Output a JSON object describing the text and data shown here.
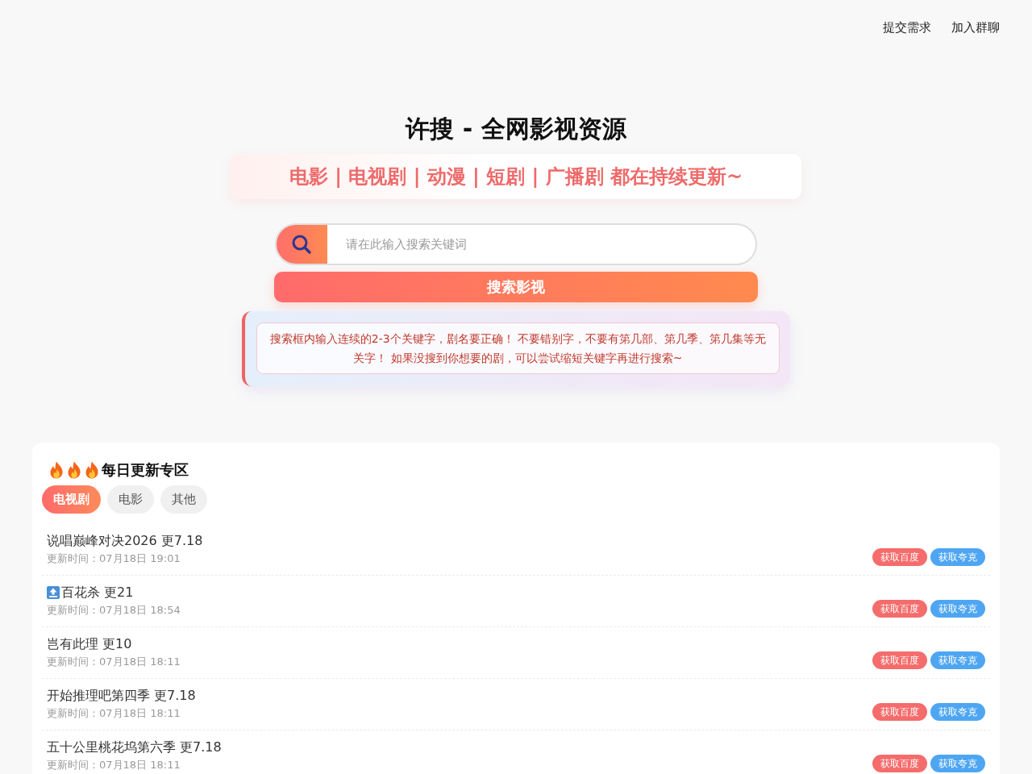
{
  "nav": {
    "links": [
      "提交需求",
      "加入群聊"
    ]
  },
  "hero": {
    "title": "许搜 - 全网影视资源",
    "subtitle": "电影 | 电视剧 | 动漫 | 短剧 | 广播剧 都在持续更新~"
  },
  "search": {
    "placeholder": "请在此输入搜索关键词",
    "button": "搜索影视"
  },
  "notice": "搜索框内输入连续的2-3个关键字，剧名要正确！ 不要错别字，不要有第几部、第几季、第几集等无关字！ 如果没搜到你想要的剧，可以尝试缩短关键字再进行搜索~",
  "updates": {
    "title": "每日更新专区",
    "tabs": [
      {
        "label": "电视剧",
        "selected": true
      },
      {
        "label": "电影",
        "selected": false
      },
      {
        "label": "其他",
        "selected": false
      }
    ],
    "items": [
      {
        "title": "说唱巅峰对决2026 更7.18",
        "pinned": false,
        "time": "更新时间：07月18日 19:01",
        "buttons": [
          {
            "label": "获取百度",
            "kind": "baidu"
          },
          {
            "label": "获取夸克",
            "kind": "quark"
          }
        ]
      },
      {
        "title": "百花杀 更21",
        "pinned": true,
        "time": "更新时间：07月18日 18:54",
        "buttons": [
          {
            "label": "获取百度",
            "kind": "baidu"
          },
          {
            "label": "获取夸克",
            "kind": "quark"
          }
        ]
      },
      {
        "title": "岂有此理 更10",
        "pinned": false,
        "time": "更新时间：07月18日 18:11",
        "buttons": [
          {
            "label": "获取百度",
            "kind": "baidu"
          },
          {
            "label": "获取夸克",
            "kind": "quark"
          }
        ]
      },
      {
        "title": "开始推理吧第四季 更7.18",
        "pinned": false,
        "time": "更新时间：07月18日 18:11",
        "buttons": [
          {
            "label": "获取百度",
            "kind": "baidu"
          },
          {
            "label": "获取夸克",
            "kind": "quark"
          }
        ]
      },
      {
        "title": "五十公里桃花坞第六季 更7.18",
        "pinned": false,
        "time": "更新时间：07月18日 18:11",
        "buttons": [
          {
            "label": "获取百度",
            "kind": "baidu"
          },
          {
            "label": "获取夸克",
            "kind": "quark"
          }
        ]
      }
    ]
  }
}
